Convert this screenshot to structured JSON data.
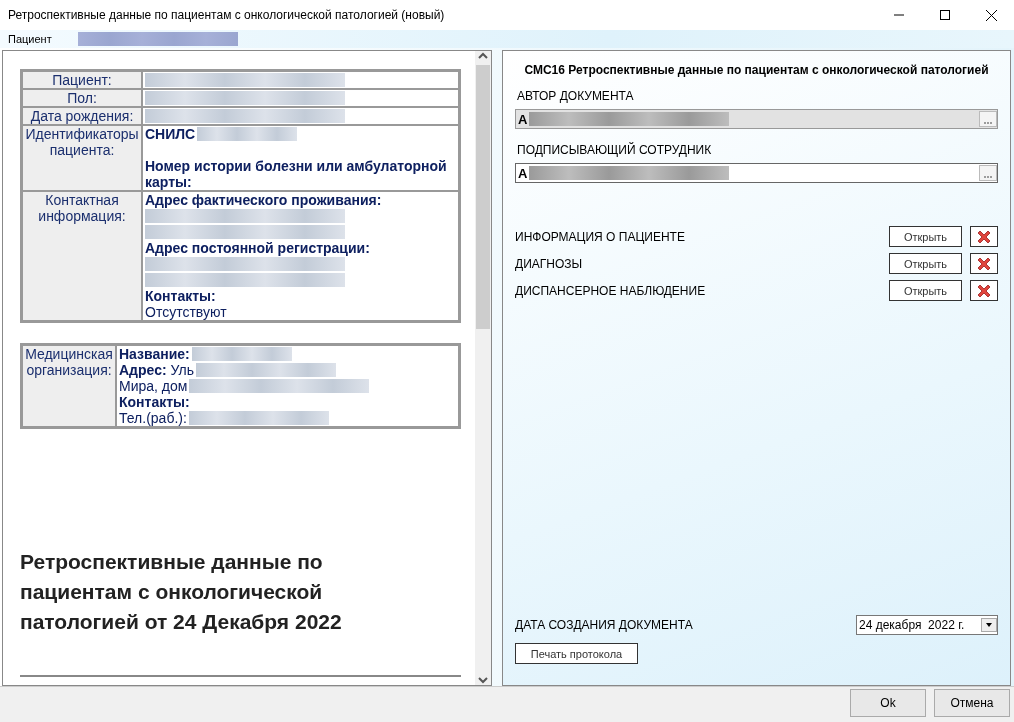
{
  "window": {
    "title": "Ретроспективные данные по пациентам с онкологической патологией (новый)"
  },
  "patient_bar": {
    "label": "Пациент"
  },
  "report": {
    "patient_table": [
      {
        "label": "Пациент:",
        "lines": [
          {
            "kind": "masked"
          }
        ]
      },
      {
        "label": "Пол:",
        "lines": [
          {
            "kind": "masked"
          }
        ]
      },
      {
        "label": "Дата рождения:",
        "lines": [
          {
            "kind": "masked"
          }
        ]
      },
      {
        "label": "Идентификаторы пациента:",
        "lines": [
          {
            "kind": "masked",
            "text": "**СНИЛС**"
          },
          {
            "kind": "blank"
          },
          {
            "kind": "text",
            "text": "**Номер истории болезни или амбулаторной карты:**"
          }
        ]
      },
      {
        "label": "Контактная информация:",
        "lines": [
          {
            "kind": "text",
            "text": "**Адрес фактического проживания:**"
          },
          {
            "kind": "masked"
          },
          {
            "kind": "masked"
          },
          {
            "kind": "text",
            "text": "**Адрес постоянной регистрации:**"
          },
          {
            "kind": "masked"
          },
          {
            "kind": "masked"
          },
          {
            "kind": "text",
            "text": "**Контакты:**"
          },
          {
            "kind": "text",
            "text": "Отсутствуют"
          }
        ]
      }
    ],
    "org_table": [
      {
        "label": "Медицинская организация:",
        "lines": [
          {
            "kind": "masked",
            "text": "**Название:**"
          },
          {
            "kind": "masked",
            "text": "**Адрес:** Уль"
          },
          {
            "kind": "masked",
            "text": "Мира, дом"
          },
          {
            "kind": "text",
            "text": "**Контакты:**"
          },
          {
            "kind": "masked",
            "text": "Тел.(раб.):"
          }
        ]
      }
    ],
    "heading": "Ретроспективные данные по пациентам с онкологической патологией от 24 Декабря 2022"
  },
  "form": {
    "title": "СМС16 Ретроспективные данные по пациентам с онкологической патологией",
    "fields": [
      {
        "label": "АВТОР ДОКУМЕНТА",
        "value": "А",
        "disabled": true
      },
      {
        "label": "ПОДПИСЫВАЮЩИЙ СОТРУДНИК",
        "value": "А",
        "disabled": false
      }
    ],
    "sections": [
      {
        "label": "ИНФОРМАЦИЯ О ПАЦИЕНТЕ",
        "button": "Открыть"
      },
      {
        "label": "ДИАГНОЗЫ",
        "button": "Открыть"
      },
      {
        "label": "ДИСПАНСЕРНОЕ НАБЛЮДЕНИЕ",
        "button": "Открыть"
      }
    ],
    "date": {
      "label": "ДАТА СОЗДАНИЯ ДОКУМЕНТА",
      "value": "24 декабря  2022 г."
    },
    "print_button": "Печать протокола"
  },
  "buttons": [
    "Ok",
    "Отмена"
  ]
}
